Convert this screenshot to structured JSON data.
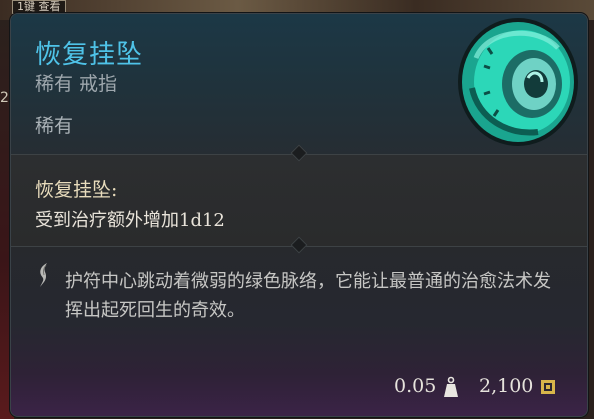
{
  "background": {
    "hint_text": "1键 查看",
    "side_number": "2"
  },
  "item": {
    "name": "恢复挂坠",
    "category": "稀有 戒指",
    "rarity": "稀有",
    "property_name": "恢复挂坠:",
    "property_desc": "受到治疗额外增加1d12",
    "flavor_text": "护符中心跳动着微弱的绿色脉络，它能让最普通的治愈法术发挥出起死回生的奇效。",
    "weight": "0.05",
    "value": "2,100",
    "icon": "jade-ring-icon"
  },
  "colors": {
    "title": "#4fc3e8",
    "rarity_accent": "#2ed3b0"
  }
}
